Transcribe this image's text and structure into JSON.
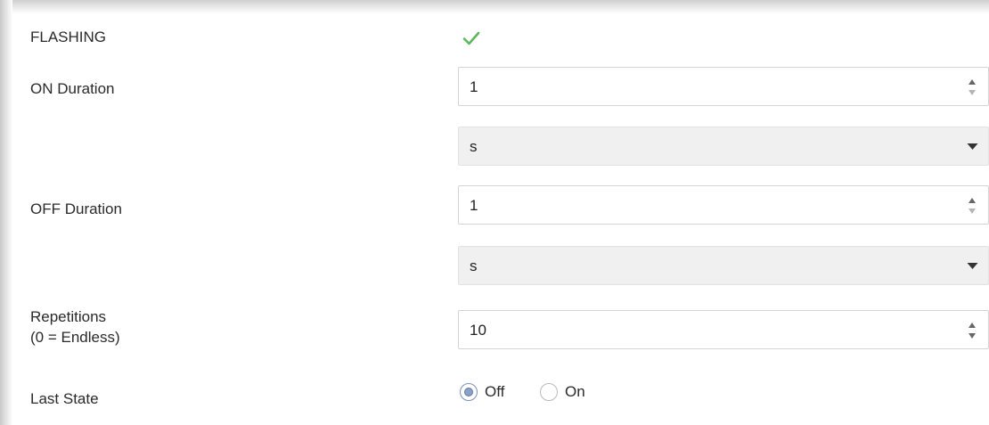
{
  "form": {
    "flashing": {
      "label": "FLASHING",
      "checked": true
    },
    "on_duration": {
      "label": "ON Duration",
      "value": "1",
      "unit": "s"
    },
    "off_duration": {
      "label": "OFF Duration",
      "value": "1",
      "unit": "s"
    },
    "repetitions": {
      "label_line1": "Repetitions",
      "label_line2": "(0 = Endless)",
      "value": "10"
    },
    "last_state": {
      "label": "Last State",
      "options": [
        {
          "label": "Off",
          "selected": true
        },
        {
          "label": "On",
          "selected": false
        }
      ]
    }
  },
  "icons": {
    "check": "check-icon",
    "spinner": "spinner-arrows-icon",
    "dropdown": "chevron-down-icon"
  },
  "colors": {
    "check": "#5cb85c",
    "radio_selected": "#8aa0c4",
    "field_border": "#d4d4d4",
    "select_bg": "#f0f0f0"
  }
}
